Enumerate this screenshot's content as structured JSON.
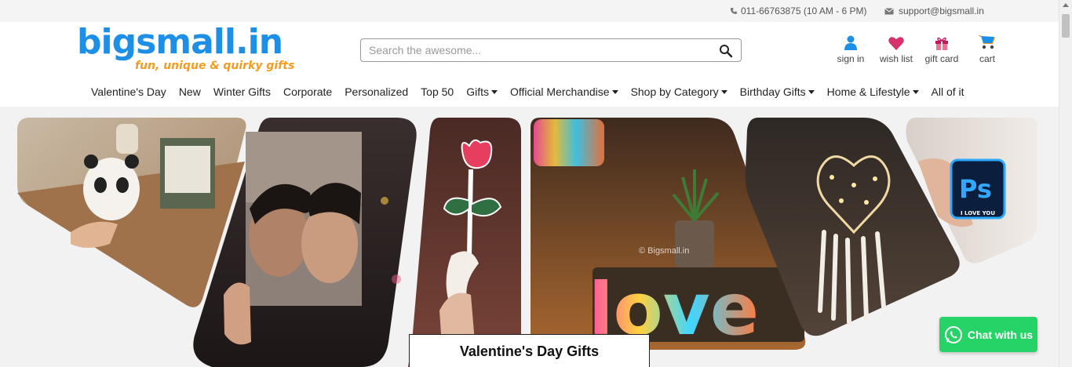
{
  "topbar": {
    "phone": "011-66763875 (10 AM - 6 PM)",
    "email": "support@bigsmall.in"
  },
  "brand": {
    "name": "bigsmall.in",
    "tagline": "fun, unique & quirky gifts",
    "primary_color": "#1e8fe6",
    "accent_color": "#f39c1f"
  },
  "search": {
    "placeholder": "Search the awesome...",
    "value": ""
  },
  "actions": [
    {
      "label": "sign in",
      "icon": "user-icon"
    },
    {
      "label": "wish list",
      "icon": "heart-icon"
    },
    {
      "label": "gift card",
      "icon": "gift-icon"
    },
    {
      "label": "cart",
      "icon": "cart-icon"
    }
  ],
  "nav": [
    {
      "label": "Valentine's Day",
      "dropdown": false
    },
    {
      "label": "New",
      "dropdown": false
    },
    {
      "label": "Winter Gifts",
      "dropdown": false
    },
    {
      "label": "Corporate",
      "dropdown": false
    },
    {
      "label": "Personalized",
      "dropdown": false
    },
    {
      "label": "Top 50",
      "dropdown": false
    },
    {
      "label": "Gifts",
      "dropdown": true
    },
    {
      "label": "Official Merchandise",
      "dropdown": true
    },
    {
      "label": "Shop by Category",
      "dropdown": true
    },
    {
      "label": "Birthday Gifts",
      "dropdown": true
    },
    {
      "label": "Home & Lifestyle",
      "dropdown": true
    },
    {
      "label": "All of it",
      "dropdown": false
    }
  ],
  "banner": {
    "caption": "Valentine's Day Gifts",
    "watermark": "© Bigsmall.in",
    "neon_text": "love",
    "ps_badge": "Ps",
    "ps_badge_caption": "I LOVE YOU",
    "slider_color": "#f2f2f2"
  },
  "chat": {
    "label": "Chat with us",
    "color": "#25d366"
  }
}
